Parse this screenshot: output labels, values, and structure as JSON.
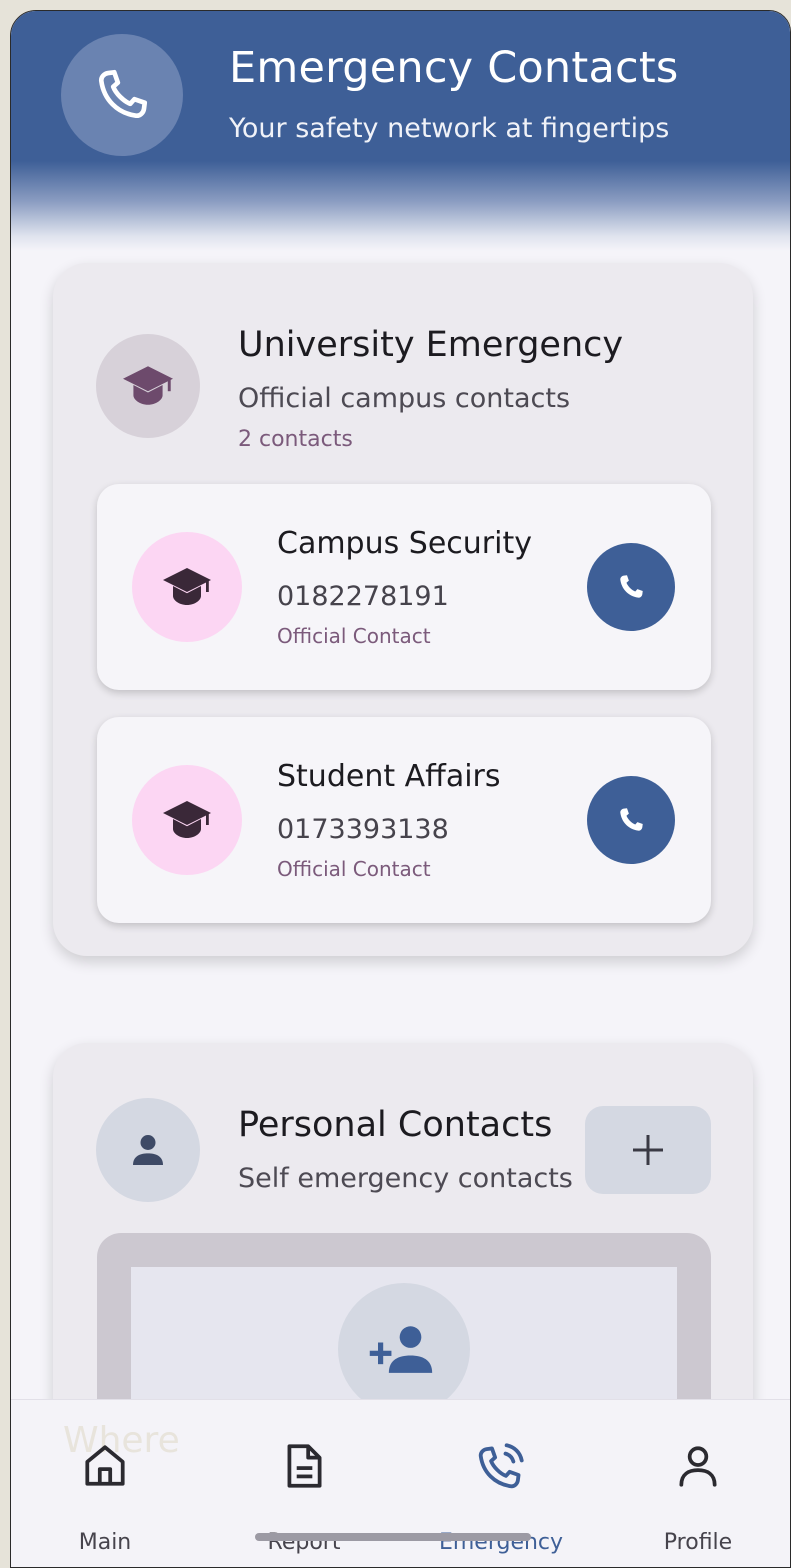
{
  "header": {
    "title": "Emergency Contacts",
    "subtitle": "Your safety network at fingertips",
    "icon": "phone-icon"
  },
  "university": {
    "title": "University Emergency",
    "subtitle": "Official campus contacts",
    "count": "2 contacts",
    "icon": "graduation-cap-icon",
    "contacts": [
      {
        "name": "Campus Security",
        "phone": "0182278191",
        "tag": "Official Contact"
      },
      {
        "name": "Student Affairs",
        "phone": "0173393138",
        "tag": "Official Contact"
      }
    ]
  },
  "personal": {
    "title": "Personal Contacts",
    "subtitle": "Self emergency contacts",
    "icon": "person-icon",
    "add_icon": "plus-icon",
    "empty_icon": "add-person-icon"
  },
  "nav": {
    "watermark": "Where",
    "items": [
      {
        "label": "Main",
        "icon": "home-icon",
        "active": false
      },
      {
        "label": "Report",
        "icon": "document-icon",
        "active": false
      },
      {
        "label": "Emergency",
        "icon": "phone-call-icon",
        "active": true
      },
      {
        "label": "Profile",
        "icon": "profile-icon",
        "active": false
      }
    ]
  },
  "colors": {
    "primary": "#3e5f97",
    "contact_avatar_bg": "#fcd6f3",
    "accent_text": "#7b5a7b"
  }
}
